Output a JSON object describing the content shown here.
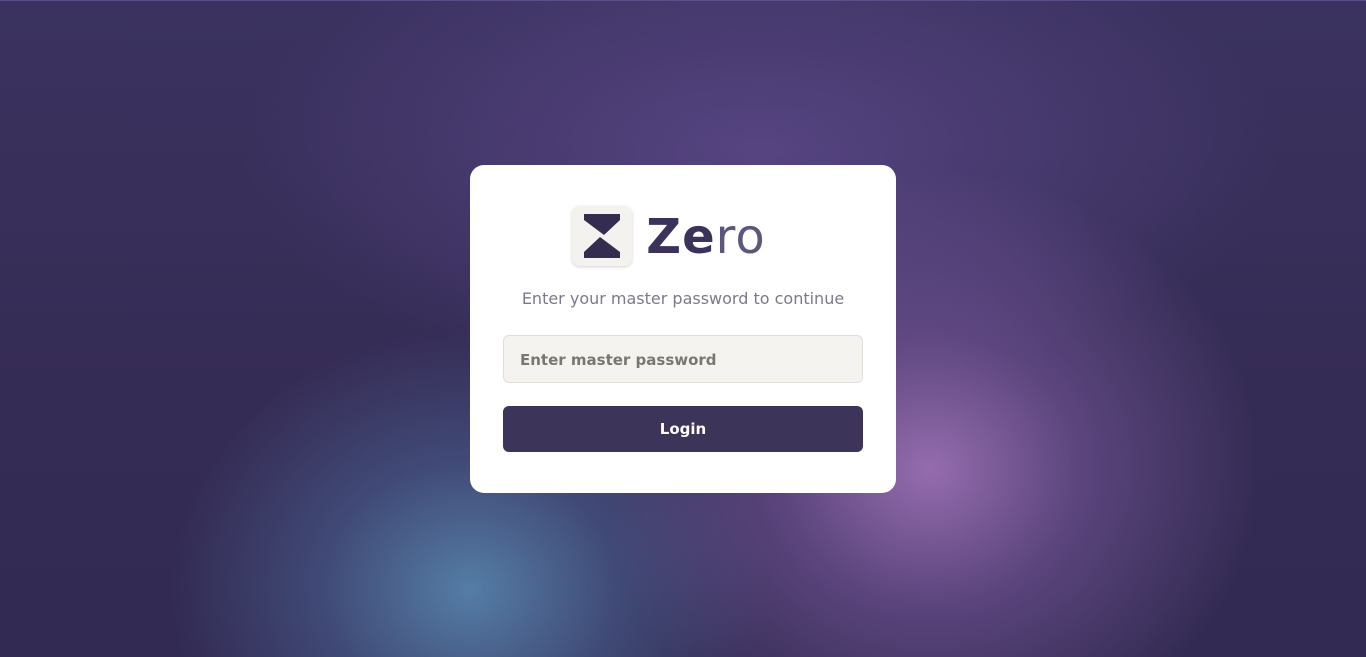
{
  "app": {
    "name_part1": "Ze",
    "name_part2": "ro",
    "logo_icon": "zero-logo-icon"
  },
  "login": {
    "subtitle": "Enter your master password to continue",
    "password_placeholder": "Enter master password",
    "password_value": "",
    "login_label": "Login"
  },
  "colors": {
    "primary": "#3d3559",
    "background": "#352c55",
    "card": "#ffffff",
    "input_bg": "#f5f3ef",
    "muted_text": "#7c7a88"
  }
}
